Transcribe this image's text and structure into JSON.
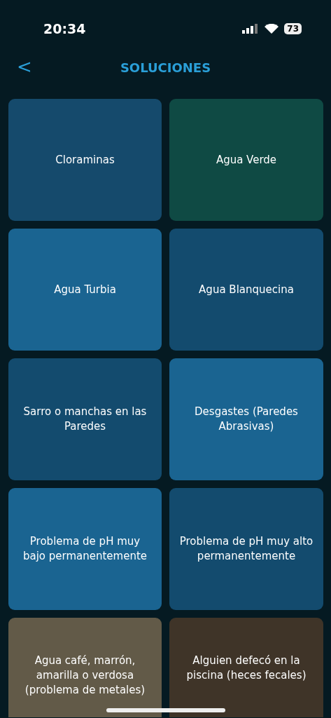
{
  "status_bar": {
    "time": "20:34",
    "battery": "73"
  },
  "header": {
    "back": "<",
    "title": "SOLUCIONES"
  },
  "tiles": [
    {
      "label": "Cloraminas",
      "color": "#154a6c"
    },
    {
      "label": "Agua Verde",
      "color": "#0f4a44"
    },
    {
      "label": "Agua Turbia",
      "color": "#1a6491"
    },
    {
      "label": "Agua Blanquecina",
      "color": "#134b6e"
    },
    {
      "label": "Sarro o manchas en las Paredes",
      "color": "#134b6e"
    },
    {
      "label": "Desgastes (Paredes Abrasivas)",
      "color": "#1a6491"
    },
    {
      "label": "Problema de pH muy bajo permanentemente",
      "color": "#1a6491"
    },
    {
      "label": "Problema de pH muy alto permanentemente",
      "color": "#134b6e"
    },
    {
      "label": "Agua café, marrón, amarilla o verdosa (problema de metales)",
      "color": "#625a48"
    },
    {
      "label": "Alguien defecó en la piscina (heces fecales)",
      "color": "#3f3428"
    }
  ]
}
